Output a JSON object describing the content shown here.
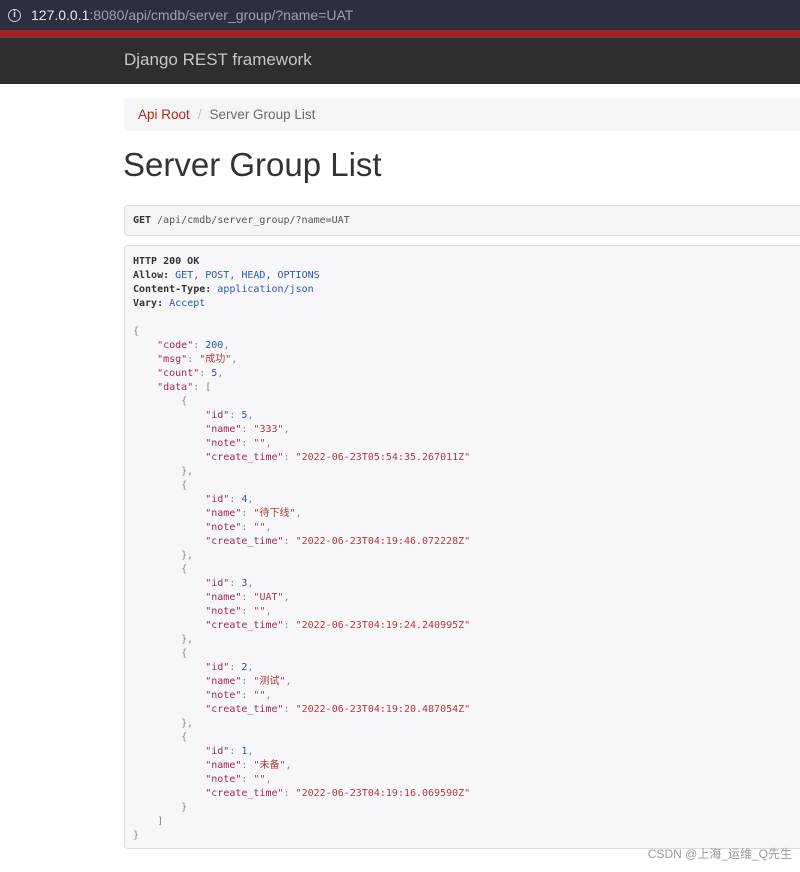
{
  "browser": {
    "url_host": "127.0.0.1",
    "url_rest": ":8080/api/cmdb/server_group/?name=UAT"
  },
  "navbar": {
    "brand": "Django REST framework"
  },
  "breadcrumb": {
    "root": "Api Root",
    "separator": "/",
    "current": "Server Group List"
  },
  "page": {
    "title": "Server Group List"
  },
  "request": {
    "method": "GET",
    "path": "/api/cmdb/server_group/?name=UAT"
  },
  "response": {
    "status": "HTTP 200 OK",
    "headers": [
      {
        "key": "Allow:",
        "value": "GET, POST, HEAD, OPTIONS"
      },
      {
        "key": "Content-Type:",
        "value": "application/json"
      },
      {
        "key": "Vary:",
        "value": "Accept"
      }
    ],
    "body": {
      "code": 200,
      "msg": "成功",
      "count": 5,
      "data": [
        {
          "id": 5,
          "name": "333",
          "note": "",
          "create_time": "2022-06-23T05:54:35.267011Z"
        },
        {
          "id": 4,
          "name": "待下线",
          "note": "",
          "create_time": "2022-06-23T04:19:46.072228Z"
        },
        {
          "id": 3,
          "name": "UAT",
          "note": "",
          "create_time": "2022-06-23T04:19:24.240995Z"
        },
        {
          "id": 2,
          "name": "测试",
          "note": "",
          "create_time": "2022-06-23T04:19:20.487054Z"
        },
        {
          "id": 1,
          "name": "未备",
          "note": "",
          "create_time": "2022-06-23T04:19:16.069590Z"
        }
      ]
    }
  },
  "watermark": "CSDN @上海_运维_Q先生",
  "colors": {
    "brand_stripe": "#a71e23",
    "navbar_bg": "#2e2e2e",
    "link": "#a82a1e",
    "address_bar_bg": "#2b2f40"
  }
}
